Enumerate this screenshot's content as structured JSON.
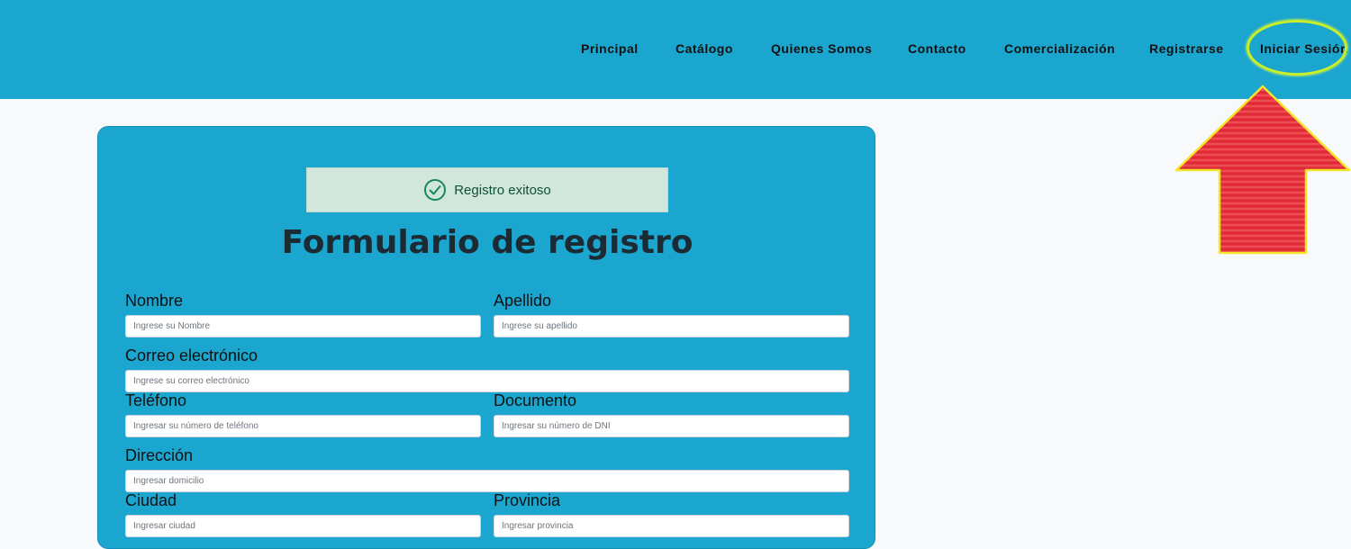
{
  "nav": {
    "items": [
      {
        "label": "Principal"
      },
      {
        "label": "Catálogo"
      },
      {
        "label": "Quienes Somos"
      },
      {
        "label": "Contacto"
      },
      {
        "label": "Comercialización"
      },
      {
        "label": "Registrarse"
      },
      {
        "label": "Iniciar Sesión"
      }
    ]
  },
  "annotation": {
    "highlight_color": "#c9ee2a",
    "arrow_color": "#e8323c",
    "arrow_outline_color": "#f3e62a"
  },
  "alert": {
    "icon": "check-circle-icon",
    "text": "Registro exitoso"
  },
  "form": {
    "title": "Formulario de registro",
    "fields": {
      "nombre": {
        "label": "Nombre",
        "placeholder": "Ingrese su Nombre"
      },
      "apellido": {
        "label": "Apellido",
        "placeholder": "Ingrese su apellido"
      },
      "correo": {
        "label": "Correo electrónico",
        "placeholder": "Ingrese su correo electrónico"
      },
      "telefono": {
        "label": "Teléfono",
        "placeholder": "Ingresar su número de teléfono"
      },
      "documento": {
        "label": "Documento",
        "placeholder": "Ingresar su número de DNI"
      },
      "direccion": {
        "label": "Dirección",
        "placeholder": "Ingresar domicilio"
      },
      "ciudad": {
        "label": "Ciudad",
        "placeholder": "Ingresar ciudad"
      },
      "provincia": {
        "label": "Provincia",
        "placeholder": "Ingresar provincia"
      }
    }
  },
  "colors": {
    "header_bg": "#1ba6cf",
    "page_bg": "#f8f9fa",
    "alert_bg": "#d1e7dd",
    "alert_text": "#0f5132"
  }
}
